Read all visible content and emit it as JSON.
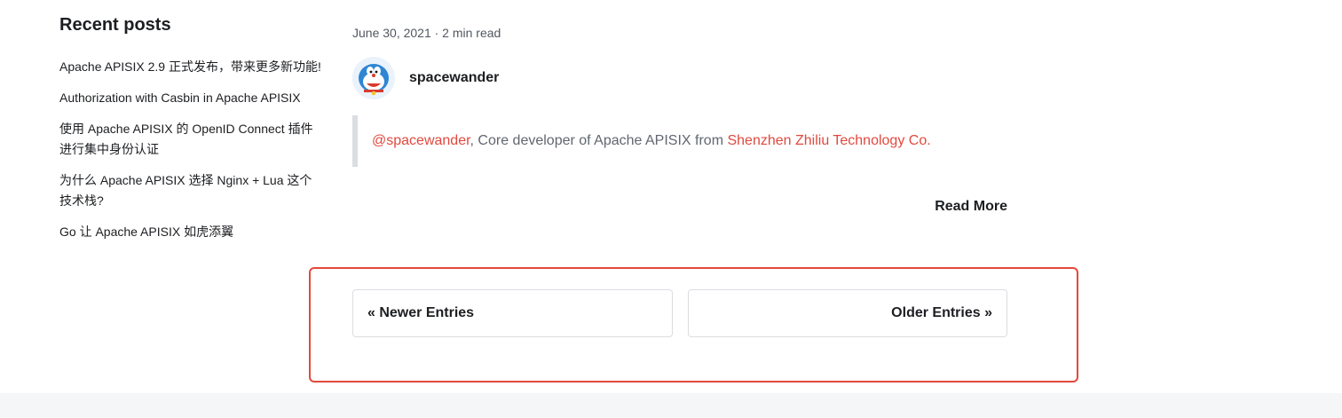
{
  "sidebar": {
    "title": "Recent posts",
    "items": [
      {
        "label": "Apache APISIX 2.9 正式发布，带来更多新功能!"
      },
      {
        "label": "Authorization with Casbin in Apache APISIX"
      },
      {
        "label": "使用 Apache APISIX 的 OpenID Connect 插件进行集中身份认证"
      },
      {
        "label": "为什么 Apache APISIX 选择 Nginx + Lua 这个技术栈?"
      },
      {
        "label": "Go 让 Apache APISIX 如虎添翼"
      }
    ]
  },
  "post": {
    "meta": "June 30, 2021 · 2 min read",
    "author": "spacewander",
    "quote_handle": "@spacewander",
    "quote_text": ", Core developer of Apache APISIX from ",
    "quote_company": "Shenzhen Zhiliu Technology Co.",
    "read_more": "Read More"
  },
  "pagination": {
    "newer": "« Newer Entries",
    "older": "Older Entries »"
  },
  "colors": {
    "accent": "#e0493e",
    "highlight_border": "#e5483b"
  }
}
